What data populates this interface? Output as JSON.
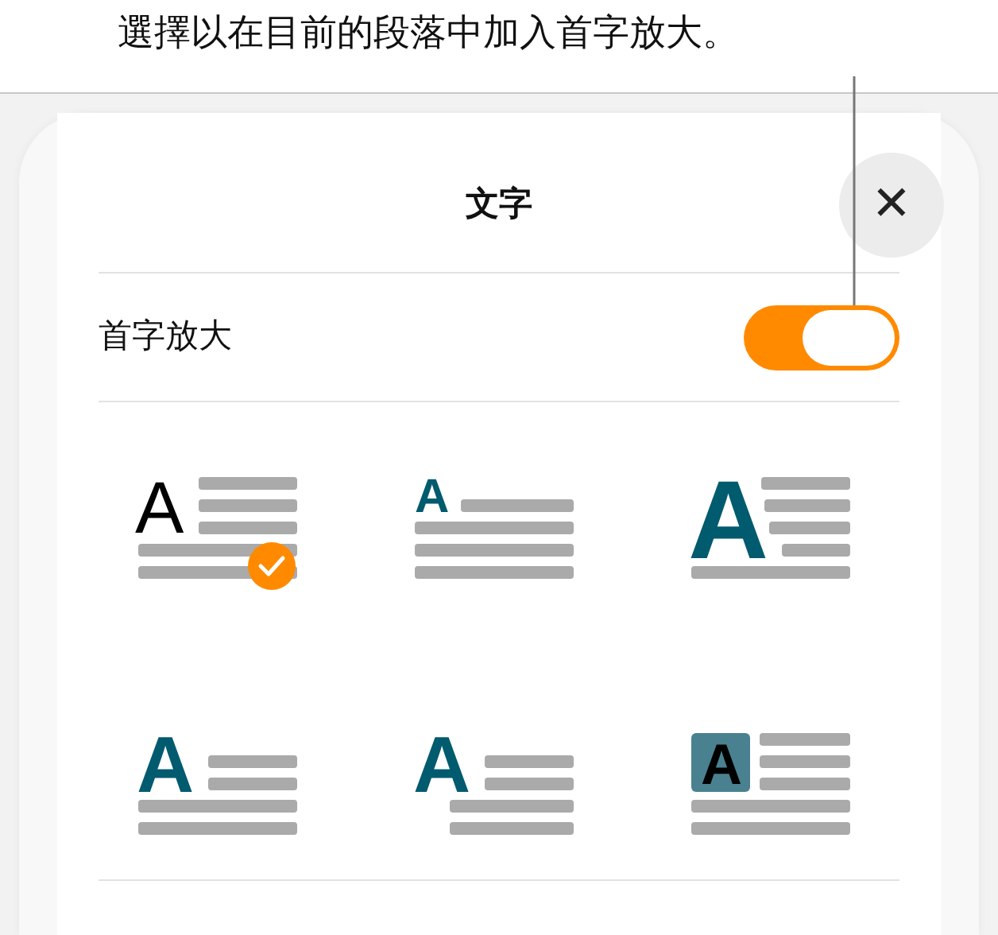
{
  "callout": {
    "text": "選擇以在目前的段落中加入首字放大。"
  },
  "sheet": {
    "title": "文字",
    "close_label": "✕"
  },
  "drop_cap": {
    "label": "首字放大",
    "on": true
  },
  "styles": [
    {
      "kind": "classic",
      "letter": "A",
      "selected": true
    },
    {
      "kind": "raised",
      "letter": "A",
      "selected": false
    },
    {
      "kind": "large",
      "letter": "A",
      "selected": false
    },
    {
      "kind": "two-line",
      "letter": "A",
      "selected": false
    },
    {
      "kind": "offset",
      "letter": "A",
      "selected": false
    },
    {
      "kind": "boxed",
      "letter": "A",
      "selected": false
    }
  ]
}
